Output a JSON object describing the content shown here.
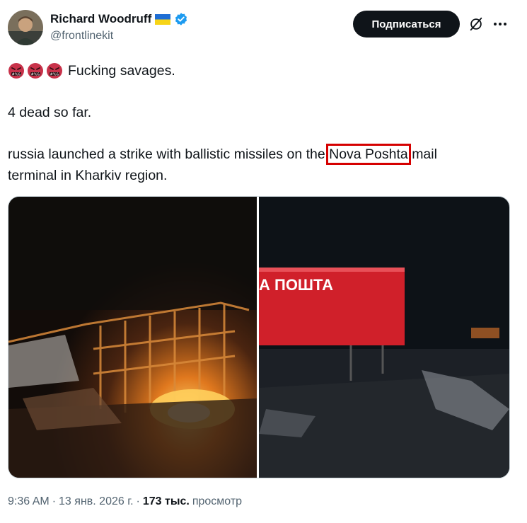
{
  "author": {
    "name": "Richard Woodruff",
    "handle": "@frontlinekit",
    "verified": true,
    "flag": "Ukraine"
  },
  "actions": {
    "follow_label": "Подписаться",
    "grok_icon": "grok-icon",
    "more_icon": "more-icon"
  },
  "tweet": {
    "line1": "Fucking savages.",
    "line2": "4 dead so far.",
    "line3_prefix": "russia launched a strike with ballistic missiles on the ",
    "line3_highlight": "Nova Poshta",
    "line3_suffix": "mail",
    "line4": "terminal in Kharkiv region."
  },
  "media": {
    "right_sign_text": "А ПОШТА"
  },
  "footer": {
    "time": "9:36 AM",
    "sep1": "·",
    "date": "13 янв. 2026 г.",
    "sep2": "·",
    "views": "173 тыс.",
    "views_label": "просмотр"
  },
  "colors": {
    "highlight_box": "#d50000",
    "sign_red": "#d0202a",
    "verified_blue": "#1d9bf0"
  }
}
